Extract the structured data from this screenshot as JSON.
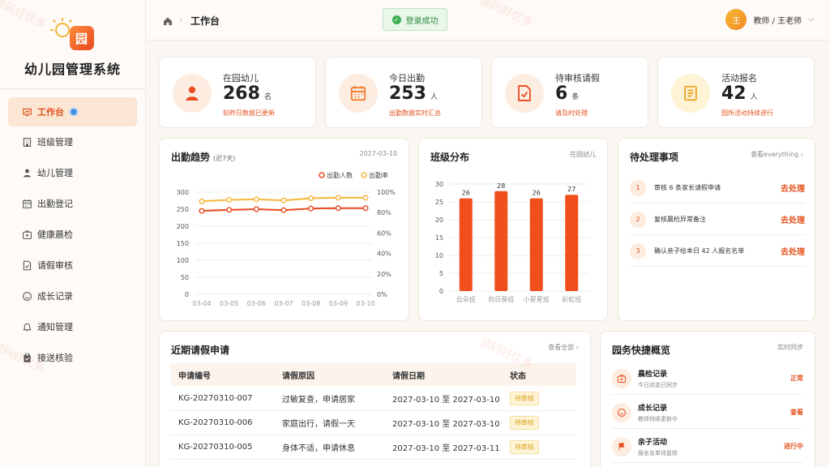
{
  "app": {
    "title": "幼儿园管理系统",
    "logo_char": "园"
  },
  "sidebar": {
    "items": [
      {
        "label": "工作台",
        "icon": "dashboard-icon",
        "active": true
      },
      {
        "label": "班级管理",
        "icon": "building-icon"
      },
      {
        "label": "幼儿管理",
        "icon": "child-icon"
      },
      {
        "label": "出勤登记",
        "icon": "calendar-icon"
      },
      {
        "label": "健康晨检",
        "icon": "medical-kit-icon"
      },
      {
        "label": "请假审核",
        "icon": "document-check-icon"
      },
      {
        "label": "成长记录",
        "icon": "smile-icon"
      },
      {
        "label": "通知管理",
        "icon": "bell-icon"
      },
      {
        "label": "接送核验",
        "icon": "clipboard-check-icon"
      }
    ]
  },
  "header": {
    "breadcrumb": "工作台",
    "toast": "登录成功",
    "user": {
      "avatar": "王",
      "name": "教师 / 王老师"
    }
  },
  "stats": [
    {
      "label": "在园幼儿",
      "value": "268",
      "unit": "名",
      "sub": "较昨日数据已更新",
      "icon": "person-icon",
      "bg": "#fdece0",
      "color": "#e84a1e"
    },
    {
      "label": "今日出勤",
      "value": "253",
      "unit": "人",
      "sub": "出勤数据实时汇总",
      "icon": "calendar-icon",
      "bg": "#fdece0",
      "color": "#f07a2e"
    },
    {
      "label": "待审核请假",
      "value": "6",
      "unit": "条",
      "sub": "请及时处理",
      "icon": "document-check-icon",
      "bg": "#fdece0",
      "color": "#e84a1e"
    },
    {
      "label": "活动报名",
      "value": "42",
      "unit": "人",
      "sub": "园所活动持续进行",
      "icon": "list-icon",
      "bg": "#fff3d6",
      "color": "#e8a21e"
    }
  ],
  "attendance": {
    "title": "出勤趋势",
    "subtitle": "(近7天)",
    "date": "2027-03-10",
    "legend": [
      "出勤人数",
      "出勤率"
    ]
  },
  "classes": {
    "title": "班级分布",
    "meta": "在园幼儿"
  },
  "todo": {
    "title": "待处理事项",
    "more": "查看everything",
    "items": [
      {
        "num": "1",
        "text": "审核 6 条家长请假申请",
        "action": "去处理"
      },
      {
        "num": "2",
        "text": "复核晨检异常备注",
        "action": "去处理"
      },
      {
        "num": "3",
        "text": "确认亲子绘本日 42 人报名名单",
        "action": "去处理"
      }
    ]
  },
  "leave": {
    "title": "近期请假申请",
    "more": "查看全部",
    "columns": [
      "申请编号",
      "请假原因",
      "请假日期",
      "状态"
    ],
    "rows": [
      {
        "id": "KG-20270310-007",
        "reason": "过敏复查，申请居家",
        "date": "2027-03-10 至 2027-03-10",
        "status": "待审核"
      },
      {
        "id": "KG-20270310-006",
        "reason": "家庭出行，请假一天",
        "date": "2027-03-10 至 2027-03-10",
        "status": "待审核"
      },
      {
        "id": "KG-20270310-005",
        "reason": "身体不适，申请休息",
        "date": "2027-03-10 至 2027-03-11",
        "status": "待审核"
      }
    ]
  },
  "quick": {
    "title": "园务快捷概览",
    "meta": "实时同步",
    "items": [
      {
        "title": "晨检记录",
        "sub": "今日状态已同步",
        "status": "正常",
        "icon": "medical-kit-icon"
      },
      {
        "title": "成长记录",
        "sub": "教师持续更新中",
        "status": "查看",
        "icon": "smile-icon"
      },
      {
        "title": "亲子活动",
        "sub": "报名名单待复核",
        "status": "进行中",
        "icon": "flag-icon"
      }
    ]
  },
  "watermark": "源码好优多",
  "chart_data": [
    {
      "type": "line",
      "title": "出勤趋势",
      "x": [
        "03-04",
        "03-05",
        "03-06",
        "03-07",
        "03-08",
        "03-09",
        "03-10"
      ],
      "series": [
        {
          "name": "出勤人数",
          "axis": "left",
          "values": [
            245,
            248,
            250,
            247,
            252,
            253,
            253
          ],
          "color": "#e84a1e"
        },
        {
          "name": "出勤率",
          "axis": "right",
          "values": [
            91,
            92.5,
            93,
            92,
            94,
            94.5,
            94.5
          ],
          "color": "#f4b73a"
        }
      ],
      "yleft": {
        "ticks": [
          0,
          50,
          100,
          150,
          200,
          250,
          300
        ],
        "lim": [
          0,
          300
        ]
      },
      "yright": {
        "ticks": [
          "0%",
          "20%",
          "40%",
          "60%",
          "80%",
          "100%"
        ],
        "lim": [
          0,
          100
        ]
      },
      "grid": true,
      "legend": "top-right"
    },
    {
      "type": "bar",
      "title": "班级分布",
      "categories": [
        "云朵班",
        "向日葵班",
        "小星星班",
        "彩虹班"
      ],
      "values": [
        26,
        28,
        26,
        27
      ],
      "ylim": [
        0,
        30
      ],
      "yticks": [
        0,
        5,
        10,
        15,
        20,
        25,
        30
      ],
      "color": "#f04e1a",
      "grid": true
    }
  ]
}
